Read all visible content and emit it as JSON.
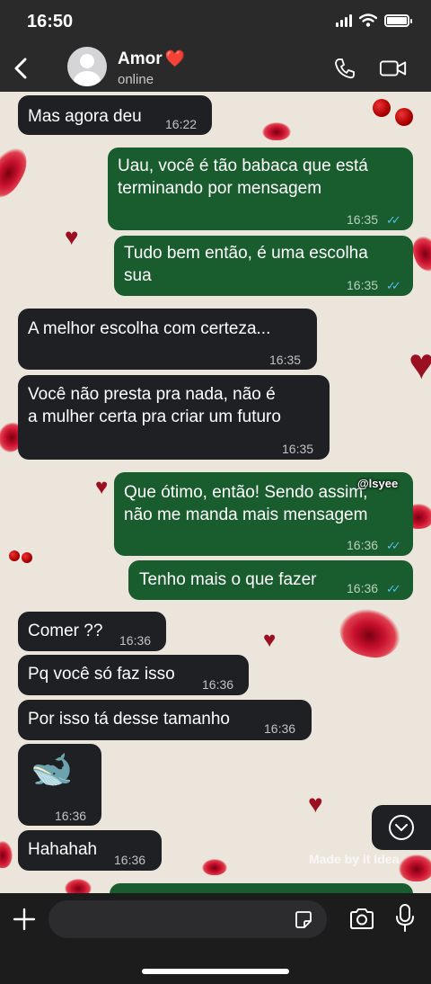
{
  "status_bar": {
    "time": "16:50"
  },
  "header": {
    "contact_name": "Amor",
    "contact_emoji": "❤️",
    "contact_status": "online",
    "icons": [
      "back-icon",
      "phone-icon",
      "video-icon"
    ]
  },
  "messages": [
    {
      "dir": "in",
      "lines": [
        "Mas agora deu"
      ],
      "time": "16:22"
    },
    {
      "dir": "out",
      "lines": [
        "Uau, você é tão babaca que está",
        "terminando por mensagem"
      ],
      "time": "16:35"
    },
    {
      "dir": "out",
      "lines": [
        "Tudo bem então, é uma escolha",
        "sua"
      ],
      "time": "16:35"
    },
    {
      "dir": "in",
      "lines": [
        "A melhor escolha com certeza..."
      ],
      "time": "16:35"
    },
    {
      "dir": "in",
      "lines": [
        "Você não presta pra nada, não é",
        "a mulher certa pra criar um futuro"
      ],
      "time": "16:35"
    },
    {
      "dir": "out",
      "lines": [
        "Que ótimo, então! Sendo assim,",
        "não me manda mais mensagem"
      ],
      "time": "16:36"
    },
    {
      "dir": "out",
      "lines": [
        "Tenho mais o que fazer"
      ],
      "time": "16:36"
    },
    {
      "dir": "in",
      "lines": [
        "Comer ??"
      ],
      "time": "16:36"
    },
    {
      "dir": "in",
      "lines": [
        "Pq você só faz isso"
      ],
      "time": "16:36"
    },
    {
      "dir": "in",
      "lines": [
        "Por isso tá desse tamanho"
      ],
      "time": "16:36"
    },
    {
      "dir": "in",
      "emoji": "🐋",
      "time": "16:36"
    },
    {
      "dir": "in",
      "lines": [
        "Hahahah"
      ],
      "time": "16:36"
    }
  ],
  "watermark": "@lsyee",
  "made_by": "Made by it Idea",
  "input": {
    "placeholder": ""
  },
  "colors": {
    "incoming": "#1f2023",
    "outgoing": "#195c2d",
    "read_ticks": "#53bdeb",
    "wallpaper": "#ece5dc"
  }
}
